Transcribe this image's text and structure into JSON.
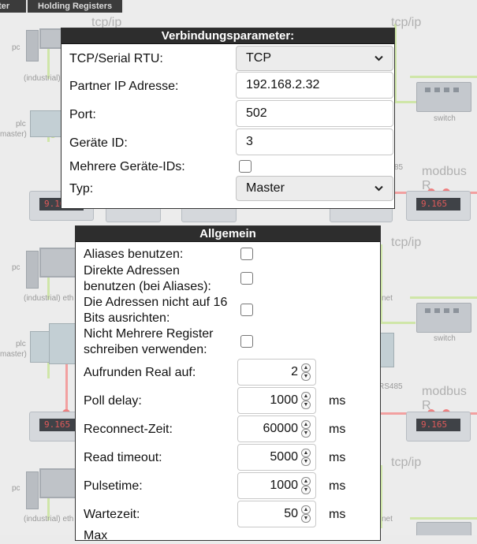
{
  "tabs": [
    "ster",
    "Holding Registers"
  ],
  "background": {
    "labels_tcpip": [
      "tcp/ip",
      "tcp/ip",
      "tcp/ip",
      "tcp/ip",
      "tcp/ip",
      "tcp/ip"
    ],
    "label_pc": "pc",
    "label_industrial": "(industrial)",
    "label_industrial_eth": "(industrial) eth",
    "label_plc": "plc",
    "label_master": "master)",
    "label_switch": "switch",
    "label_modbus": "modbus R",
    "label_rs485": "RS485",
    "label_85": "85",
    "label_net": "net",
    "meter_value": "9.165"
  },
  "verbindung": {
    "title": "Verbindungsparameter:",
    "tcp_serial_label": "TCP/Serial RTU:",
    "tcp_serial_value": "TCP",
    "partner_ip_label": "Partner IP Adresse:",
    "partner_ip_value": "192.168.2.32",
    "port_label": "Port:",
    "port_value": "502",
    "geraete_id_label": "Geräte ID:",
    "geraete_id_value": "3",
    "mehrere_ids_label": "Mehrere Geräte-IDs:",
    "typ_label": "Typ:",
    "typ_value": "Master"
  },
  "allgemein": {
    "title": "Allgemein",
    "aliases_label": "Aliases benutzen:",
    "direkte_label_1": "Direkte Adressen",
    "direkte_label_2": "benutzen (bei Aliases):",
    "adressen_label_1": "Die Adressen nicht auf 16",
    "adressen_label_2": "Bits ausrichten:",
    "nicht_mehrere_label_1": "Nicht Mehrere Register",
    "nicht_mehrere_label_2": "schreiben verwenden:",
    "aufrunden_label": "Aufrunden Real auf:",
    "aufrunden_value": "2",
    "poll_delay_label": "Poll delay:",
    "poll_delay_value": "1000",
    "reconnect_label": "Reconnect-Zeit:",
    "reconnect_value": "60000",
    "read_timeout_label": "Read timeout:",
    "read_timeout_value": "5000",
    "pulsetime_label": "Pulsetime:",
    "pulsetime_value": "1000",
    "wartezeit_label": "Wartezeit:",
    "wartezeit_value": "50",
    "max_label": "Max",
    "unit_ms": "ms"
  }
}
